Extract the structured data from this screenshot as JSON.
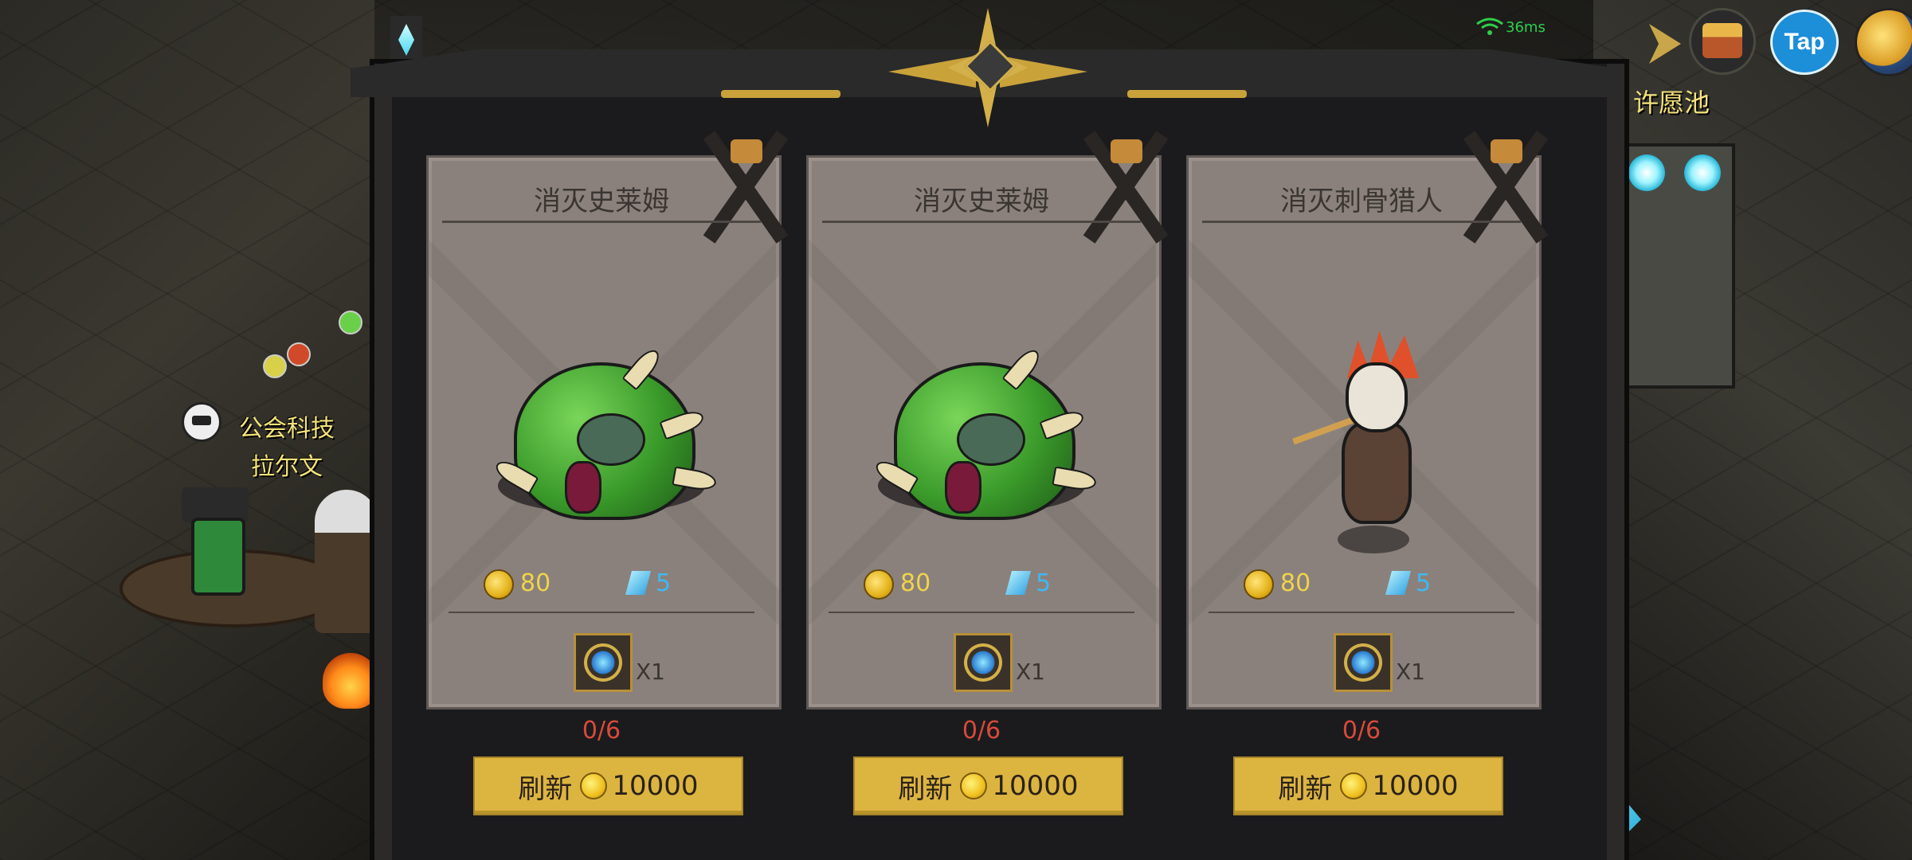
{
  "npc": {
    "line1": "公会科技",
    "line2": "拉尔文"
  },
  "hud": {
    "ping": "36ms",
    "tap_label": "Tap",
    "wish_pool_label": "许愿池"
  },
  "colors": {
    "gold_button": "#dcb440",
    "progress_red": "#d84a3a",
    "coin_text": "#f0d34a",
    "gem_text": "#40b8f0",
    "card_bg": "#8a817c"
  },
  "quests": [
    {
      "title": "消灭史莱姆",
      "monster": "slime",
      "gold": "80",
      "gems": "5",
      "item_qty": "X1",
      "progress": "0/6",
      "refresh_label": "刷新",
      "refresh_cost": "10000"
    },
    {
      "title": "消灭史莱姆",
      "monster": "slime",
      "gold": "80",
      "gems": "5",
      "item_qty": "X1",
      "progress": "0/6",
      "refresh_label": "刷新",
      "refresh_cost": "10000"
    },
    {
      "title": "消灭刺骨猎人",
      "monster": "bone-hunter",
      "gold": "80",
      "gems": "5",
      "item_qty": "X1",
      "progress": "0/6",
      "refresh_label": "刷新",
      "refresh_cost": "10000"
    }
  ]
}
